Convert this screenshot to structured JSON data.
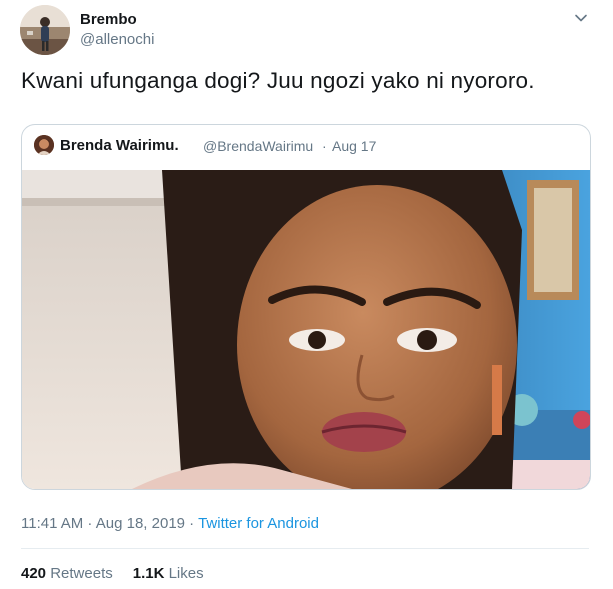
{
  "author": {
    "name": "Brembo",
    "handle": "@allenochi"
  },
  "tweet": {
    "text": "Kwani ufunganga dogi?  Juu ngozi yako ni nyororo."
  },
  "quoted_tweet": {
    "name": "Brenda Wairimu.",
    "handle": "@BrendaWairimu",
    "separator": "·",
    "date": "Aug 17"
  },
  "meta": {
    "timestamp": "11:41 AM · Aug 18, 2019 · ",
    "source": "Twitter for Android"
  },
  "stats": {
    "retweets_count": "420",
    "retweets_label": "Retweets",
    "likes_count": "1.1K",
    "likes_label": "Likes"
  },
  "colors": {
    "link": "#1b95e0",
    "secondary_text": "#657786",
    "border": "#ccd6dd"
  },
  "icons": {
    "chevron": "chevron-down-icon"
  }
}
